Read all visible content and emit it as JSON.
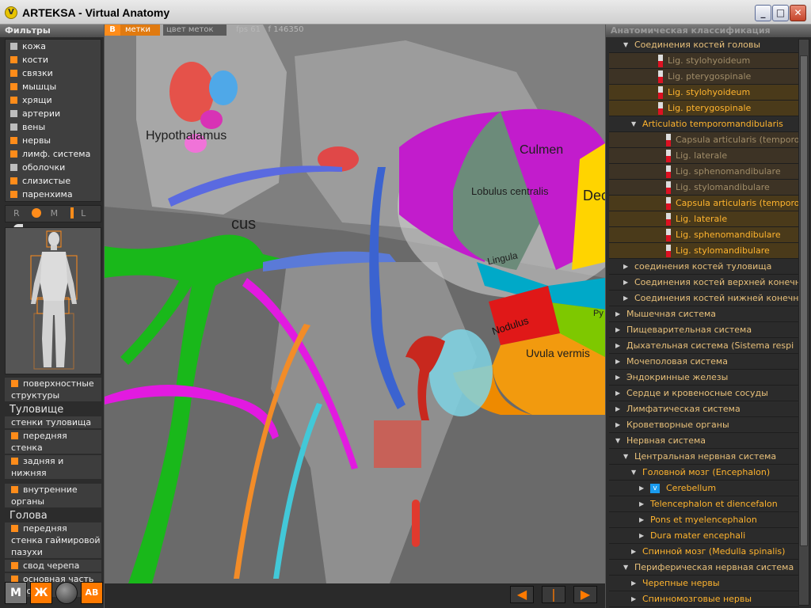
{
  "window": {
    "title": "ARTEKSA - Virtual Anatomy",
    "icon": "app-logo-icon"
  },
  "left": {
    "filters_header": "Фильтры",
    "filters": [
      {
        "label": "кожа",
        "color": "#bdbdbd"
      },
      {
        "label": "кости",
        "color": "#ff8c1a"
      },
      {
        "label": "связки",
        "color": "#ff8c1a"
      },
      {
        "label": "мышцы",
        "color": "#ff8c1a"
      },
      {
        "label": "хрящи",
        "color": "#ff8c1a"
      },
      {
        "label": "артерии",
        "color": "#bdbdbd"
      },
      {
        "label": "вены",
        "color": "#bdbdbd"
      },
      {
        "label": "нервы",
        "color": "#ff8c1a"
      },
      {
        "label": "лимф. система",
        "color": "#ff8c1a"
      },
      {
        "label": "оболочки",
        "color": "#bdbdbd"
      },
      {
        "label": "слизистые",
        "color": "#ff8c1a"
      },
      {
        "label": "паренхима",
        "color": "#ff8c1a"
      }
    ],
    "lod": {
      "r": "R",
      "m": "M",
      "l": "L"
    },
    "regions": {
      "surface": "поверхностные структуры",
      "torso_head": "Туловище",
      "torso": [
        "стенки туловища",
        "передняя стенка",
        "задняя и нижняя"
      ],
      "internal": "внутренние органы",
      "head_head": "Голова",
      "head": [
        "передняя стенка гаймировой пазухи",
        "свод черепа",
        "основная часть головы"
      ]
    },
    "tools": {
      "m": "М",
      "zh": "Ж",
      "ab": "АВ"
    }
  },
  "viewport": {
    "badge": "В",
    "tab_labels": "метки",
    "tab_label_color": "цвет меток",
    "fps_label": "fps",
    "fps": "61",
    "f_label": "f",
    "f_value": "146350",
    "labels": {
      "hypothalamus": "Hypothalamus",
      "culmen": "Culmen",
      "lobulus_centralis": "Lobulus centralis",
      "lingula": "Lingula",
      "nodulus": "Nodulus",
      "uvula_vermis": "Uvula vermis",
      "dec": "Dec",
      "pyr": "Py",
      "cus": "cus"
    }
  },
  "right": {
    "header": "Анатомическая классификация",
    "tree": [
      {
        "label": "Соединения костей головы",
        "indent": 1,
        "kind": "group",
        "open": true
      },
      {
        "label": "Lig. stylohyoideum",
        "indent": 3,
        "kind": "leaf-dim",
        "badge": "RL"
      },
      {
        "label": "Lig. pterygospinale",
        "indent": 3,
        "kind": "leaf-dim",
        "badge": "RL"
      },
      {
        "label": "Lig. stylohyoideum",
        "indent": 3,
        "kind": "leaf",
        "badge": "RL"
      },
      {
        "label": "Lig. pterygospinale",
        "indent": 3,
        "kind": "leaf",
        "badge": "RL"
      },
      {
        "label": "Articulatio temporomandibularis",
        "indent": 2,
        "kind": "group",
        "open": true
      },
      {
        "label": "Capsula articularis (temporoma",
        "indent": 4,
        "kind": "leaf-dim",
        "badge": "RL"
      },
      {
        "label": "Lig. laterale",
        "indent": 4,
        "kind": "leaf-dim",
        "badge": "RL"
      },
      {
        "label": "Lig. sphenomandibulare",
        "indent": 4,
        "kind": "leaf-dim",
        "badge": "RL"
      },
      {
        "label": "Lig. stylomandibulare",
        "indent": 4,
        "kind": "leaf-dim",
        "badge": "RL"
      },
      {
        "label": "Capsula articularis (temporoma",
        "indent": 4,
        "kind": "leaf",
        "badge": "RL"
      },
      {
        "label": "Lig. laterale",
        "indent": 4,
        "kind": "leaf",
        "badge": "RL"
      },
      {
        "label": "Lig. sphenomandibulare",
        "indent": 4,
        "kind": "leaf",
        "badge": "RL"
      },
      {
        "label": "Lig. stylomandibulare",
        "indent": 4,
        "kind": "leaf",
        "badge": "RL"
      },
      {
        "label": "соединения костей туловища",
        "indent": 1,
        "kind": "group"
      },
      {
        "label": "Соединения костей верхней конечнос",
        "indent": 1,
        "kind": "group"
      },
      {
        "label": "Соединения костей нижней конечнос",
        "indent": 1,
        "kind": "group"
      },
      {
        "label": "Мышечная система",
        "indent": 0,
        "kind": "group"
      },
      {
        "label": "Пищеварительная система",
        "indent": 0,
        "kind": "group"
      },
      {
        "label": "Дыхательная система  (Sistema respi",
        "indent": 0,
        "kind": "group"
      },
      {
        "label": "Мочеполовая система",
        "indent": 0,
        "kind": "group"
      },
      {
        "label": "Эндокринные железы",
        "indent": 0,
        "kind": "group"
      },
      {
        "label": "Сердце и кровеносные сосуды",
        "indent": 0,
        "kind": "group"
      },
      {
        "label": "Лимфатическая система",
        "indent": 0,
        "kind": "group"
      },
      {
        "label": "Кроветворные органы",
        "indent": 0,
        "kind": "group"
      },
      {
        "label": "Нервная система",
        "indent": 0,
        "kind": "group",
        "open": true
      },
      {
        "label": "Центральная нервная система",
        "indent": 1,
        "kind": "group",
        "open": true
      },
      {
        "label": "Головной мозг  (Encephalon)",
        "indent": 2,
        "kind": "group",
        "open": true
      },
      {
        "label": "Cerebellum",
        "indent": 3,
        "kind": "checked"
      },
      {
        "label": "Telencephalon et diencefalon",
        "indent": 3,
        "kind": "group"
      },
      {
        "label": "Pons et myelencephalon",
        "indent": 3,
        "kind": "group"
      },
      {
        "label": "Dura mater encephali",
        "indent": 3,
        "kind": "group"
      },
      {
        "label": "Спинной мозг  (Medulla spinalis)",
        "indent": 2,
        "kind": "group"
      },
      {
        "label": "Периферическая нервная система",
        "indent": 1,
        "kind": "group",
        "open": true
      },
      {
        "label": "Черепные нервы",
        "indent": 2,
        "kind": "group"
      },
      {
        "label": "Спинномозговые нервы",
        "indent": 2,
        "kind": "group"
      }
    ],
    "check_mark": "v"
  },
  "nav": {
    "prev": "◀",
    "mid": "|",
    "next": "▶"
  }
}
